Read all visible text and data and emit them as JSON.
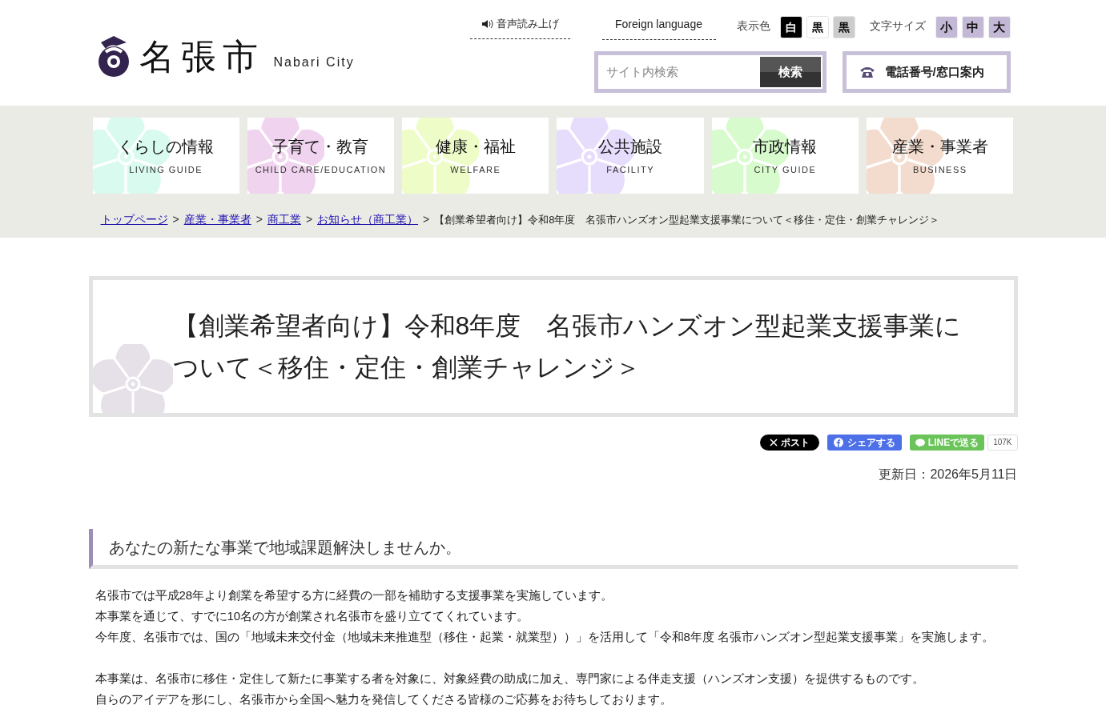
{
  "header": {
    "logo_text": "名張市",
    "logo_sub": "Nabari City",
    "voice_link": "音声読み上げ",
    "foreign_link": "Foreign language",
    "display_color_label": "表示色",
    "display_colors": [
      {
        "label": "白",
        "color": "#000000"
      },
      {
        "label": "黒",
        "color": "#ffffff"
      },
      {
        "label": "黒",
        "color": "#cccccc"
      }
    ],
    "font_size_label": "文字サイズ",
    "font_sizes": [
      "小",
      "中",
      "大"
    ],
    "search": {
      "placeholder": "サイト内検索",
      "button": "検索"
    },
    "contact_button": "電話番号/窓口案内"
  },
  "nav": [
    {
      "label": "くらしの情報",
      "sub": "LIVING GUIDE",
      "color": "#d9fbef"
    },
    {
      "label": "子育て・教育",
      "sub": "CHILD CARE/EDUCATION",
      "color": "#f0d3ee"
    },
    {
      "label": "健康・福祉",
      "sub": "WELFARE",
      "color": "#eefcc8"
    },
    {
      "label": "公共施設",
      "sub": "FACILITY",
      "color": "#e6dcfb"
    },
    {
      "label": "市政情報",
      "sub": "CITY GUIDE",
      "color": "#d7fbcc"
    },
    {
      "label": "産業・事業者",
      "sub": "BUSINESS",
      "color": "#f3dccd"
    }
  ],
  "breadcrumb": {
    "separator": ">",
    "links": [
      "トップページ",
      "産業・事業者",
      "商工業",
      "お知らせ（商工業）"
    ],
    "current": "【創業希望者向け】令和8年度　名張市ハンズオン型起業支援事業について＜移住・定住・創業チャレンジ＞"
  },
  "page_title": "【創業希望者向け】令和8年度　名張市ハンズオン型起業支援事業について＜移住・定住・創業チャレンジ＞",
  "share": {
    "x_button": "ポスト",
    "facebook_button": "シェアする",
    "line_button": "LINEで送る",
    "line_count": "107K"
  },
  "updated": "更新日：2026年5月11日",
  "section_heading": "あなたの新たな事業で地域課題解決しませんか。",
  "paragraphs": [
    [
      "名張市では平成28年より創業を希望する方に経費の一部を補助する支援事業を実施しています。",
      "本事業を通じて、すでに10名の方が創業され名張市を盛り立ててくれています。",
      "今年度、名張市では、国の「地域未来交付金（地域未来推進型（移住・起業・就業型））」を活用して「令和8年度 名張市ハンズオン型起業支援事業」を実施します。"
    ],
    [
      "本事業は、名張市に移住・定住して新たに事業する者を対象に、対象経費の助成に加え、専門家による伴走支援（ハンズオン支援）を提供するものです。",
      "自らのアイデアを形にし、名張市から全国へ魅力を発信してくださる皆様のご応募をお待ちしております。"
    ]
  ]
}
